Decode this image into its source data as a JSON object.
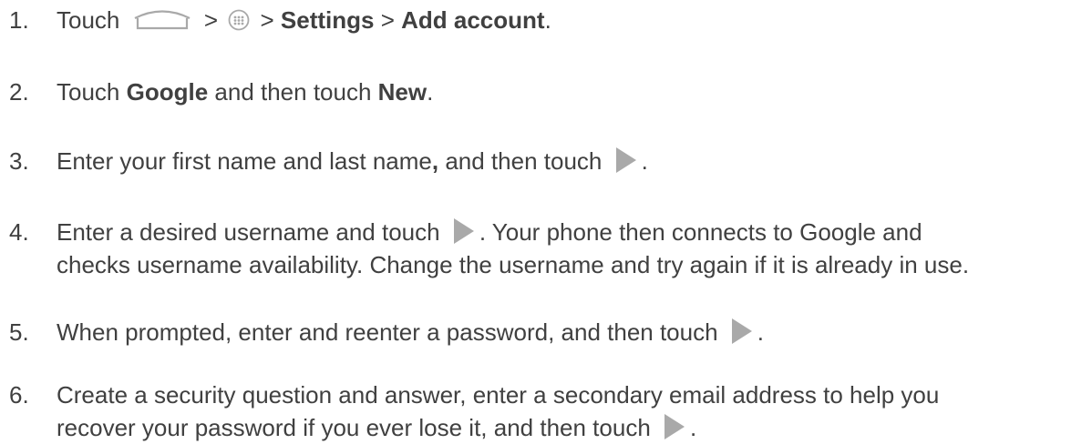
{
  "steps": [
    {
      "num": "1.",
      "t1": "Touch ",
      "t2": " > ",
      "t3": " > ",
      "b1": "Settings",
      "t4": " > ",
      "b2": "Add account",
      "t5": "."
    },
    {
      "num": "2.",
      "t1": "Touch ",
      "b1": "Google",
      "t2": " and then touch ",
      "b2": "New",
      "t3": "."
    },
    {
      "num": "3.",
      "t1": "Enter your first name and last name",
      "b1": ",",
      "t2": " and then touch ",
      "t3": "."
    },
    {
      "num": "4.",
      "t1": "Enter a desired username and touch ",
      "t2": ". Your phone then connects to Google and",
      "line2": "checks username availability. Change the username and try again if it is already in use."
    },
    {
      "num": "5.",
      "t1": "When prompted, enter and reenter a password, and then touch ",
      "t2": "."
    },
    {
      "num": "6.",
      "t1": "Create a security question and answer, enter a secondary email address to help you",
      "line2a": "recover your password if you ever lose it, and then touch ",
      "line2b": "."
    }
  ],
  "icons": {
    "home": "home-icon",
    "apps": "apps-icon",
    "next": "play-icon"
  },
  "colors": {
    "text": "#404040",
    "icon": "#a9a9a9"
  }
}
